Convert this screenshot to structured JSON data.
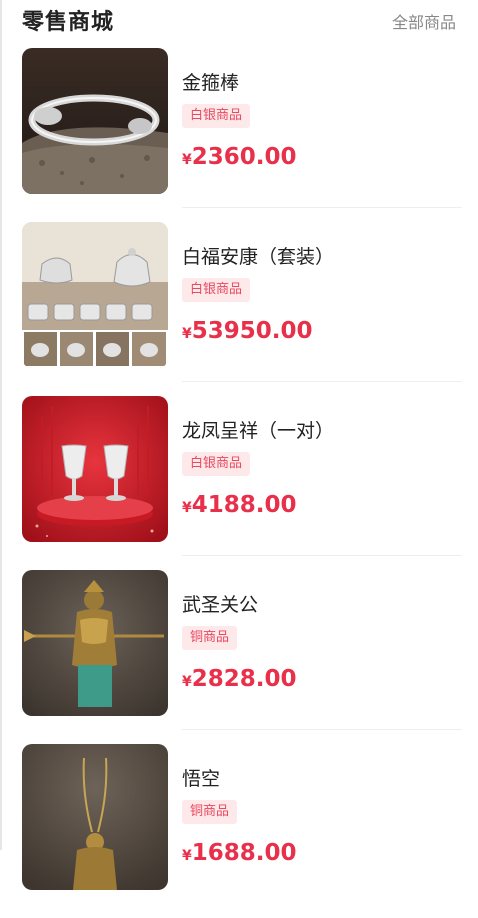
{
  "header": {
    "title": "零售商城",
    "all_label": "全部商品"
  },
  "products": [
    {
      "name": "金箍棒",
      "tag": "白银商品",
      "currency": "¥",
      "price": "2360.00",
      "image": "silver-snake-bracelet"
    },
    {
      "name": "白福安康（套装）",
      "tag": "白银商品",
      "currency": "¥",
      "price": "53950.00",
      "image": "silver-tea-set"
    },
    {
      "name": "龙凤呈祥（一对）",
      "tag": "白银商品",
      "currency": "¥",
      "price": "4188.00",
      "image": "silver-goblets"
    },
    {
      "name": "武圣关公",
      "tag": "铜商品",
      "currency": "¥",
      "price": "2828.00",
      "image": "bronze-guan-gong-statue"
    },
    {
      "name": "悟空",
      "tag": "铜商品",
      "currency": "¥",
      "price": "1688.00",
      "image": "bronze-wukong-statue"
    }
  ],
  "colors": {
    "price": "#e8304a",
    "tag_bg": "#fde8ea",
    "tag_text": "#e84a5f"
  }
}
